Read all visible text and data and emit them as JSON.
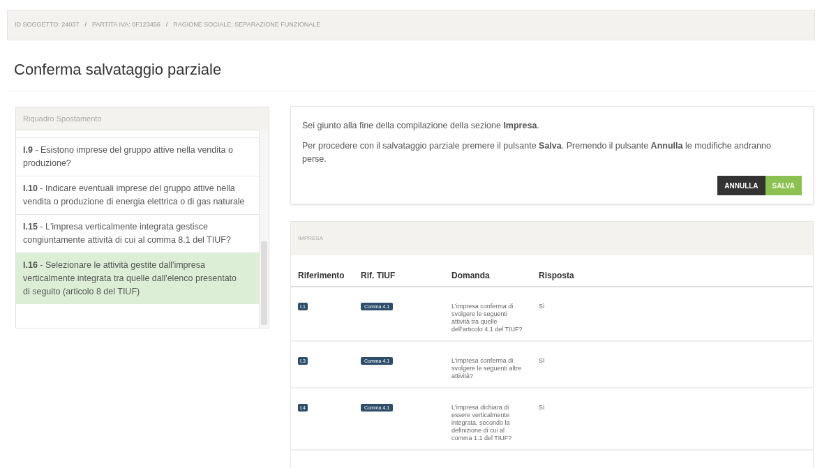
{
  "breadcrumb": {
    "separator": "/",
    "items": [
      "ID SOGGETTO: 24037",
      "PARTITA IVA: 0F123456",
      "RAGIONE SOCIALE: SEPARAZIONE FUNZIONALE"
    ]
  },
  "page_title": "Conferma salvataggio parziale",
  "sidebar": {
    "title": "Riquadro Spostamento",
    "items": [
      {
        "text": "**I.9** - Esistono imprese del gruppo attive nella vendita o produzione?",
        "selected": false
      },
      {
        "text": "**I.10** - Indicare eventuali imprese del gruppo attive nella vendita o produzione di energia elettrica o di gas naturale",
        "selected": false
      },
      {
        "text": "**I.15** - L'impresa verticalmente integrata gestisce congiuntamente attività di cui al comma 8.1 del TIUF?",
        "selected": false
      },
      {
        "text": "**I.16** - Selezionare le attività gestite dall'impresa verticalmente integrata tra quelle dall'elenco presentato di seguito (articolo 8 del TIUF)",
        "selected": true
      }
    ]
  },
  "confirm": {
    "lines": [
      "Sei giunto alla fine della compilazione della sezione **Impresa**.",
      "Per procedere con il salvataggio parziale premere il pulsante **Salva**. Premendo il pulsante **Annulla** le modifiche andranno perse."
    ],
    "buttons": [
      {
        "label": "ANNULLA",
        "kind": "cancel"
      },
      {
        "label": "SALVA",
        "kind": "save"
      }
    ]
  },
  "table": {
    "title": "IMPRESA",
    "columns": [
      "Riferimento",
      "Rif. TIUF",
      "Domanda",
      "Risposta"
    ],
    "rows": [
      {
        "ref": "I.1",
        "tiuf": "Comma 4.1",
        "question": "L'impresa conferma di svolgere le seguenti attività tra quelle dell'articolo 4.1 del TIUF?",
        "answer": "Sì"
      },
      {
        "ref": "I.3",
        "tiuf": "Comma 4.1",
        "question": "L'impresa conferma di svolgere le seguenti altre attività?",
        "answer": "Sì"
      },
      {
        "ref": "I.4",
        "tiuf": "Comma 4.1",
        "question": "L'impresa dichiara di essere verticalmente integrata, secondo la definizione di cui al comma 1.1 del TIUF?",
        "answer": "Sì"
      }
    ]
  }
}
